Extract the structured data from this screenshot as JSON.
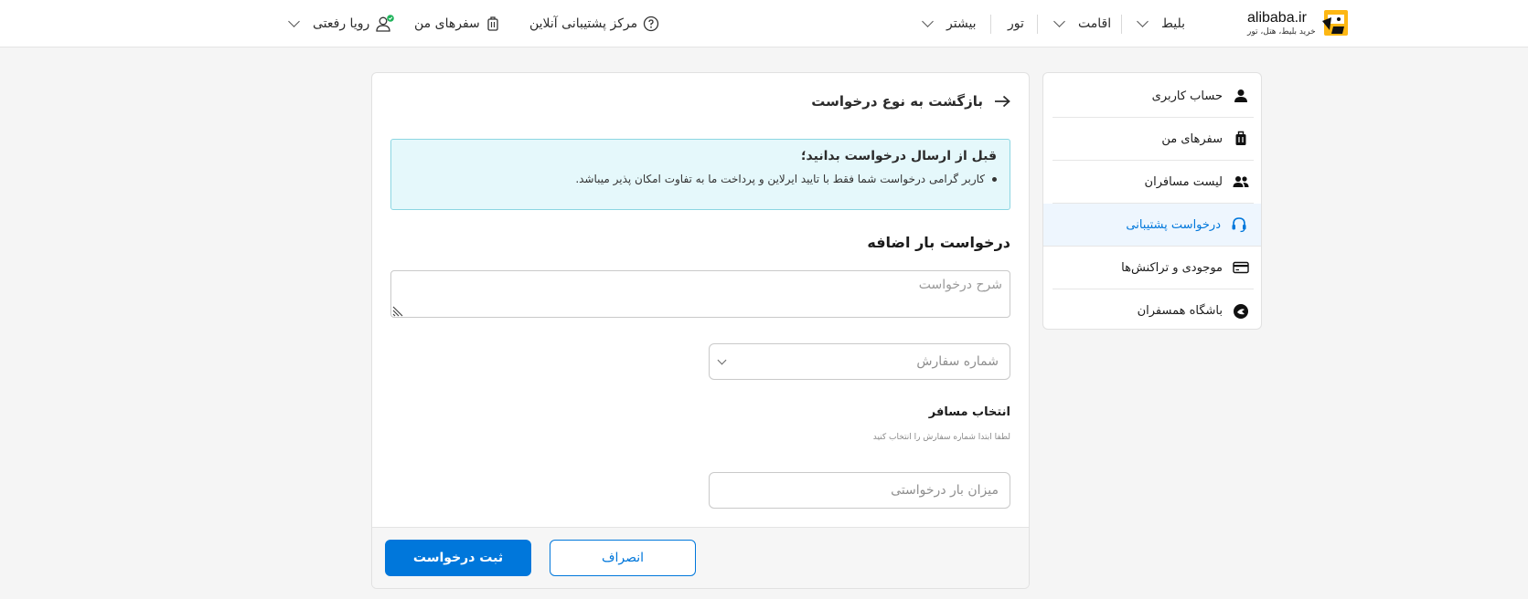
{
  "header": {
    "logo_text": "alibaba.ir",
    "logo_subtitle": "خرید بلیط، هتل، تور",
    "nav": {
      "ticket": "بلیط",
      "stay": "اقامت",
      "tour": "تور",
      "more": "بیشتر"
    },
    "support_center": "مرکز پشتیبانی آنلاین",
    "my_trips": "سفرهای من",
    "user_name": "رویا رفعتی"
  },
  "sidebar": {
    "items": [
      {
        "label": "حساب کاربری",
        "icon": "user-icon"
      },
      {
        "label": "سفرهای من",
        "icon": "suitcase-icon"
      },
      {
        "label": "لیست مسافران",
        "icon": "users-icon"
      },
      {
        "label": "درخواست پشتیبانی",
        "icon": "headset-icon"
      },
      {
        "label": "موجودی و تراکنش‌ها",
        "icon": "card-icon"
      },
      {
        "label": "باشگاه همسفران",
        "icon": "club-icon"
      }
    ],
    "active_index": 3
  },
  "main": {
    "back_label": "بازگشت به نوع درخواست",
    "notice": {
      "title": "قبل از ارسال درخواست بدانید؛",
      "item": "کاربر گرامی درخواست شما فقط با تایید ایرلاین و پرداخت ما به تفاوت امکان پذیر میباشد."
    },
    "section_title": "درخواست بار اضافه",
    "description_placeholder": "شرح درخواست",
    "order_number_placeholder": "شماره سفارش",
    "passenger_label": "انتخاب مسافر",
    "passenger_hint": "لطفا ابتدا شماره سفارش را انتخاب کنید",
    "baggage_placeholder": "میزان بار درخواستی",
    "cancel_label": "انصراف",
    "submit_label": "ثبت درخواست"
  },
  "colors": {
    "primary": "#0077db",
    "notice_bg": "#e5f8fb",
    "notice_border": "#8cd6e2",
    "online_badge": "#1eb35a"
  }
}
